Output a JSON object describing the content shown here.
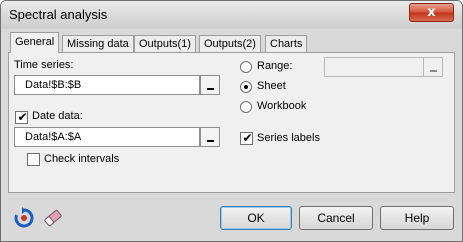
{
  "window": {
    "title": "Spectral analysis",
    "close_label": "x"
  },
  "tabs": [
    {
      "label": "General",
      "active": true
    },
    {
      "label": "Missing data",
      "active": false
    },
    {
      "label": "Outputs(1)",
      "active": false
    },
    {
      "label": "Outputs(2)",
      "active": false
    },
    {
      "label": "Charts",
      "active": false
    }
  ],
  "general": {
    "time_series_label": "Time series:",
    "time_series_value": "Data!$B:$B",
    "date_data_label": "Date data:",
    "date_data_checked": true,
    "date_data_value": "Data!$A:$A",
    "check_intervals_label": "Check intervals",
    "check_intervals_checked": false,
    "output": {
      "range_label": "Range:",
      "sheet_label": "Sheet",
      "workbook_label": "Workbook",
      "selected": "Sheet",
      "range_value": ""
    },
    "series_labels_label": "Series labels",
    "series_labels_checked": true
  },
  "footer": {
    "reset_icon": "refresh-icon",
    "clear_icon": "eraser-icon",
    "ok_label": "OK",
    "cancel_label": "Cancel",
    "help_label": "Help"
  }
}
